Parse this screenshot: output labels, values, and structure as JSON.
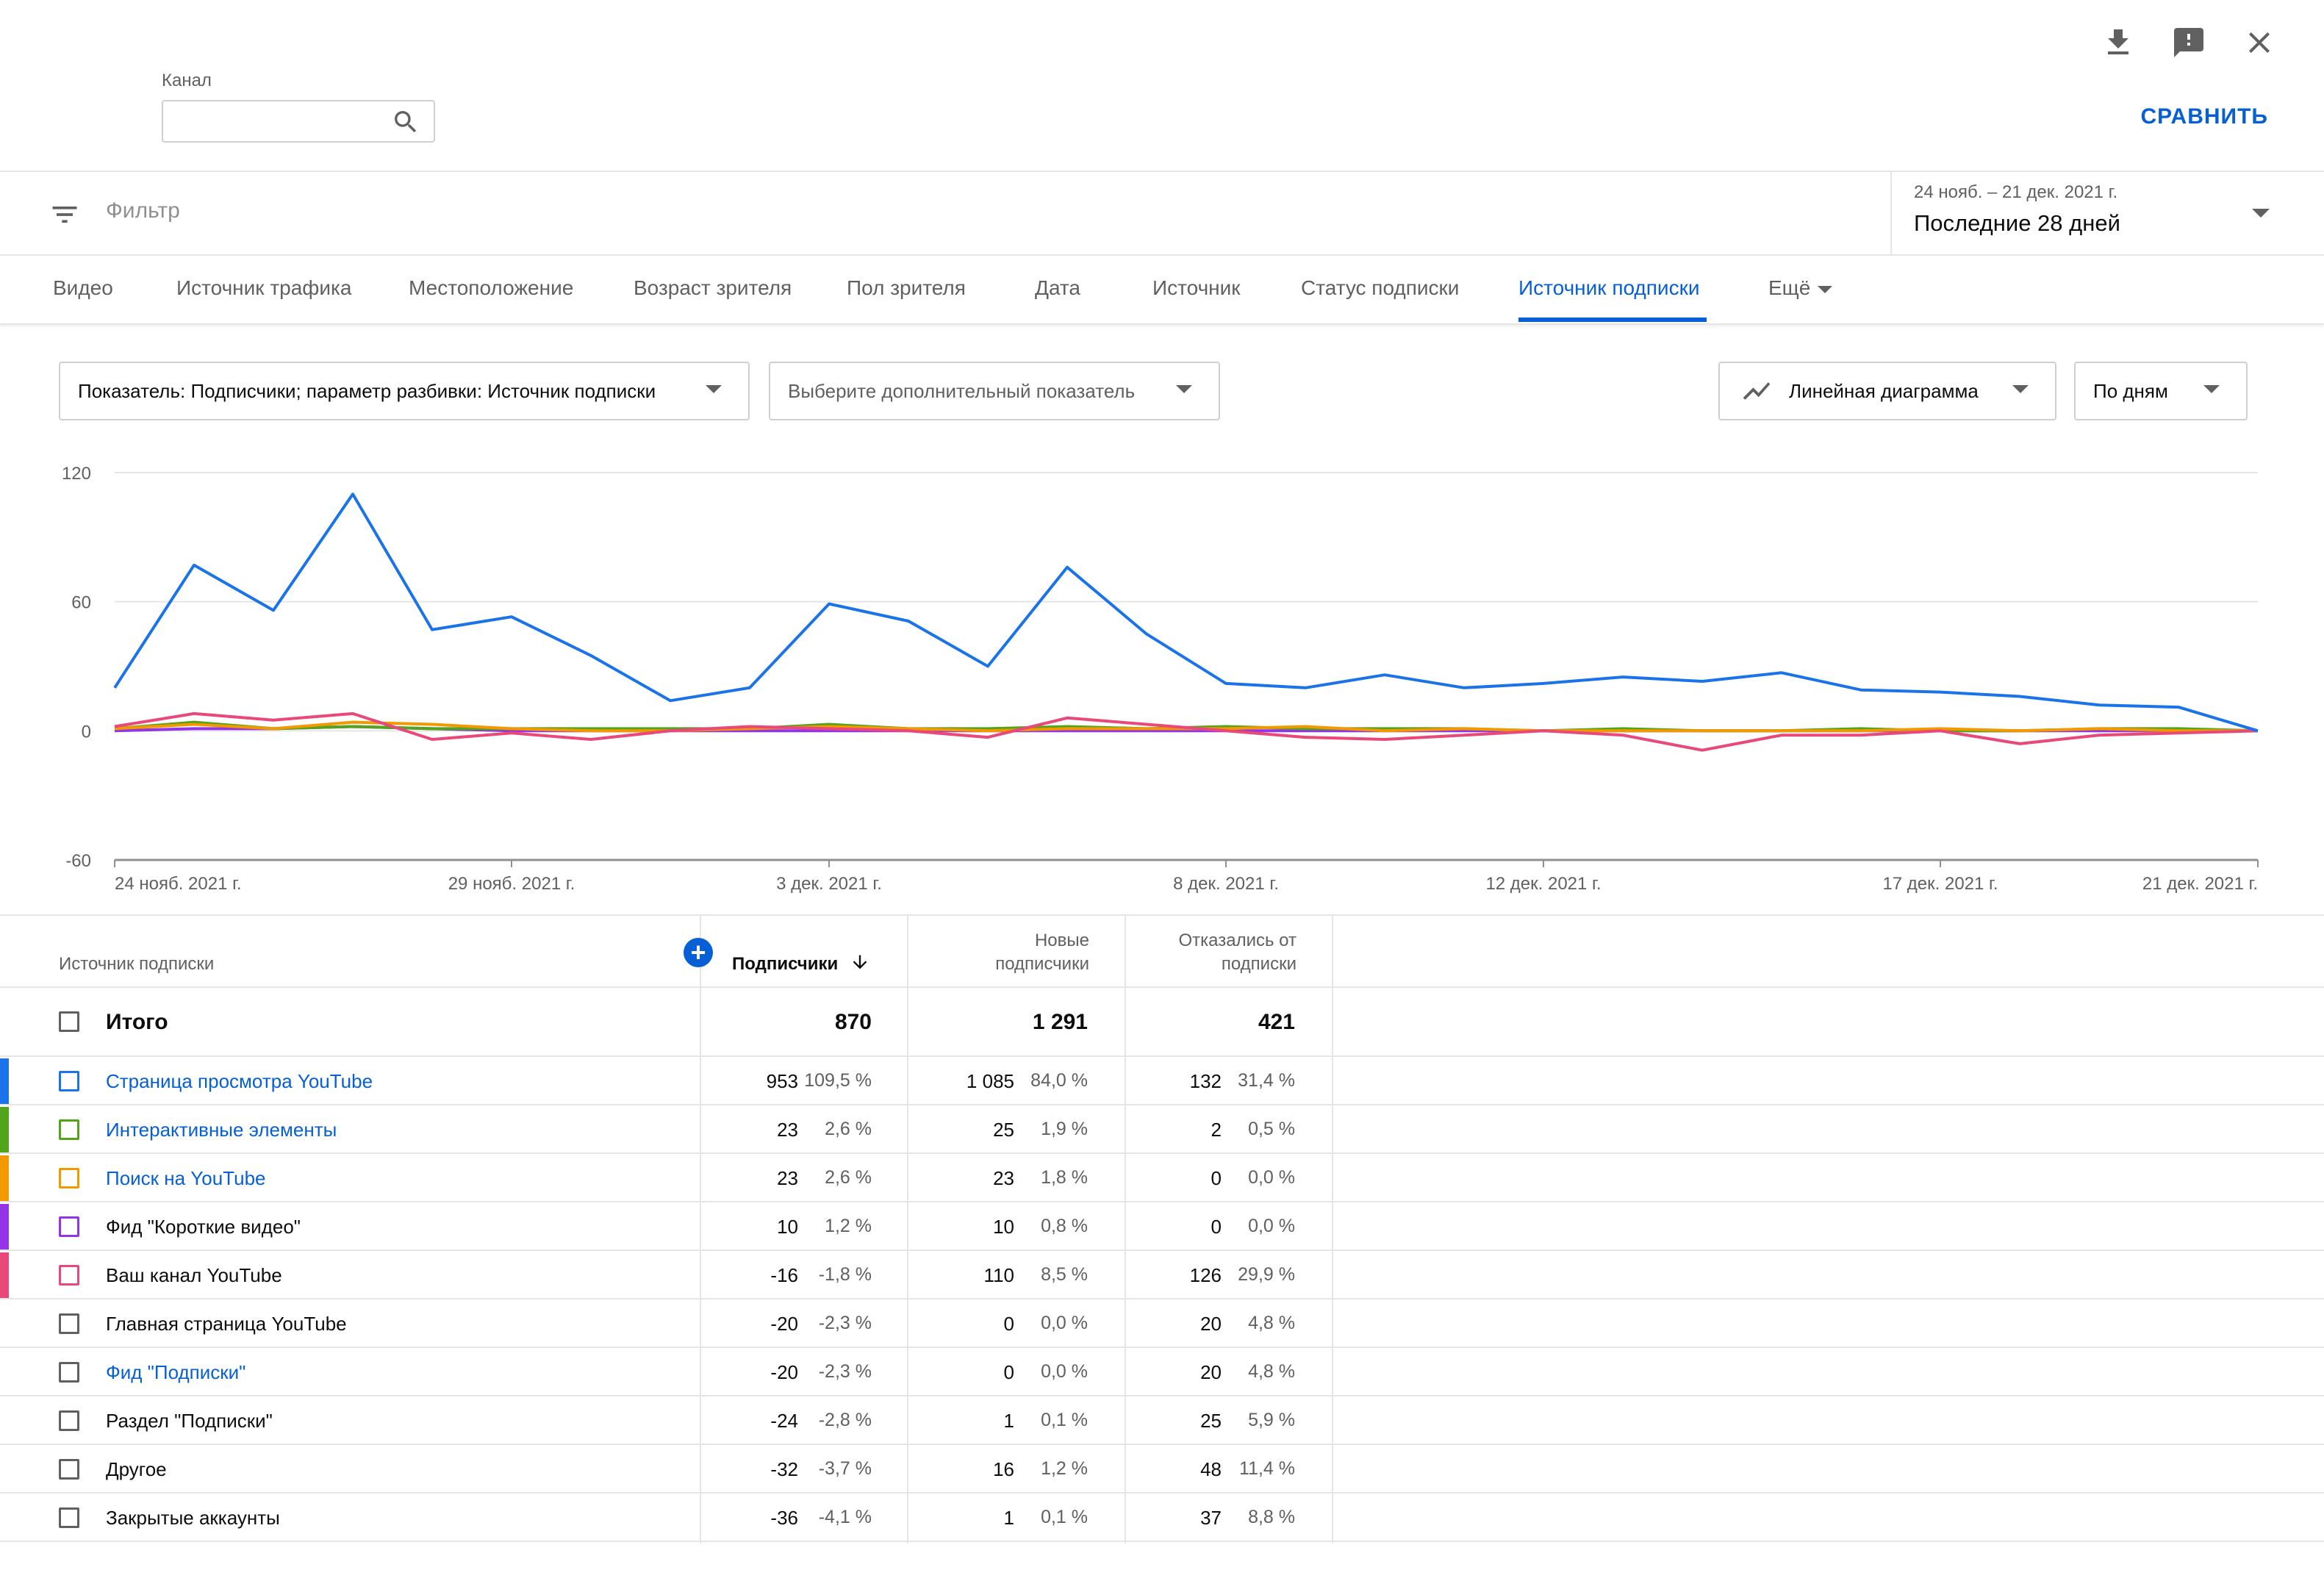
{
  "header": {
    "channel_label": "Канал",
    "channel_value": "",
    "compare_label": "СРАВНИТЬ",
    "icons": [
      "download-icon",
      "feedback-icon",
      "close-icon"
    ]
  },
  "filter": {
    "placeholder": "Фильтр",
    "date_range": "24 нояб. – 21 дек. 2021 г.",
    "period": "Последние 28 дней"
  },
  "tabs": [
    {
      "label": "Видео",
      "active": false
    },
    {
      "label": "Источник трафика",
      "active": false
    },
    {
      "label": "Местоположение",
      "active": false
    },
    {
      "label": "Возраст зрителя",
      "active": false
    },
    {
      "label": "Пол зрителя",
      "active": false
    },
    {
      "label": "Дата",
      "active": false
    },
    {
      "label": "Источник",
      "active": false
    },
    {
      "label": "Статус подписки",
      "active": false
    },
    {
      "label": "Источник подписки",
      "active": true
    },
    {
      "label": "Ещё",
      "active": false
    }
  ],
  "controls": {
    "metric": "Показатель: Подписчики; параметр разбивки: Источник подписки",
    "secondary_metric": "Выберите дополнительный показатель",
    "chart_type": "Линейная диаграмма",
    "granularity": "По дням"
  },
  "chart_data": {
    "type": "line",
    "ylim": [
      -60,
      120
    ],
    "yticks": [
      "120",
      "60",
      "0",
      "-60"
    ],
    "xtick_labels": [
      "24 нояб. 2021 г.",
      "29 нояб. 2021 г.",
      "3 дек. 2021 г.",
      "8 дек. 2021 г.",
      "12 дек. 2021 г.",
      "17 дек. 2021 г.",
      "21 дек. 2021 г."
    ],
    "xtick_index": [
      0,
      5,
      9,
      14,
      18,
      23,
      27
    ],
    "grid": true,
    "series": [
      {
        "color": "#1a73e8",
        "values": [
          20,
          77,
          56,
          110,
          47,
          53,
          35,
          14,
          20,
          59,
          51,
          30,
          76,
          45,
          22,
          20,
          26,
          20,
          22,
          25,
          23,
          27,
          19,
          18,
          16,
          12,
          11,
          0
        ]
      },
      {
        "color": "#e8497a",
        "values": [
          2,
          8,
          5,
          8,
          -4,
          -1,
          -4,
          0,
          2,
          1,
          0,
          -3,
          6,
          3,
          0,
          -3,
          -4,
          -2,
          0,
          -2,
          -9,
          -2,
          -2,
          0,
          -6,
          -2,
          -1,
          0
        ]
      },
      {
        "color": "#f29900",
        "values": [
          1,
          3,
          1,
          4,
          3,
          1,
          0,
          0,
          1,
          2,
          1,
          0,
          1,
          1,
          1,
          2,
          0,
          1,
          0,
          0,
          0,
          0,
          0,
          1,
          0,
          1,
          0,
          0
        ]
      },
      {
        "color": "#52a41a",
        "values": [
          1,
          4,
          1,
          2,
          1,
          1,
          1,
          1,
          1,
          3,
          1,
          1,
          2,
          1,
          2,
          1,
          1,
          1,
          0,
          1,
          0,
          0,
          1,
          0,
          0,
          1,
          1,
          0
        ]
      },
      {
        "color": "#9334e6",
        "values": [
          0,
          1,
          1,
          2,
          1,
          0,
          0,
          0,
          0,
          0,
          0,
          0,
          0,
          0,
          0,
          0,
          0,
          0,
          0,
          0,
          0,
          0,
          0,
          0,
          0,
          0,
          0,
          0
        ]
      }
    ]
  },
  "table": {
    "col_source": "Источник подписки",
    "col_subs": "Подписчики",
    "col_new_1": "Новые",
    "col_new_2": "подписчики",
    "col_lost_1": "Отказались от",
    "col_lost_2": "подписки",
    "total": {
      "label": "Итого",
      "subs": "870",
      "new": "1 291",
      "lost": "421"
    },
    "rows": [
      {
        "label": "Страница просмотра YouTube",
        "link": true,
        "color": "#1a73e8",
        "subs": "953",
        "subs_pct": "109,5 %",
        "new": "1 085",
        "new_pct": "84,0 %",
        "lost": "132",
        "lost_pct": "31,4 %"
      },
      {
        "label": "Интерактивные элементы",
        "link": true,
        "color": "#52a41a",
        "subs": "23",
        "subs_pct": "2,6 %",
        "new": "25",
        "new_pct": "1,9 %",
        "lost": "2",
        "lost_pct": "0,5 %"
      },
      {
        "label": "Поиск на YouTube",
        "link": true,
        "color": "#f29900",
        "subs": "23",
        "subs_pct": "2,6 %",
        "new": "23",
        "new_pct": "1,8 %",
        "lost": "0",
        "lost_pct": "0,0 %"
      },
      {
        "label": "Фид \"Короткие видео\"",
        "link": false,
        "color": "#9334e6",
        "subs": "10",
        "subs_pct": "1,2 %",
        "new": "10",
        "new_pct": "0,8 %",
        "lost": "0",
        "lost_pct": "0,0 %"
      },
      {
        "label": "Ваш канал YouTube",
        "link": false,
        "color": "#e8497a",
        "subs": "-16",
        "subs_pct": "-1,8 %",
        "new": "110",
        "new_pct": "8,5 %",
        "lost": "126",
        "lost_pct": "29,9 %"
      },
      {
        "label": "Главная страница YouTube",
        "link": false,
        "color": "",
        "subs": "-20",
        "subs_pct": "-2,3 %",
        "new": "0",
        "new_pct": "0,0 %",
        "lost": "20",
        "lost_pct": "4,8 %"
      },
      {
        "label": "Фид \"Подписки\"",
        "link": true,
        "color": "",
        "subs": "-20",
        "subs_pct": "-2,3 %",
        "new": "0",
        "new_pct": "0,0 %",
        "lost": "20",
        "lost_pct": "4,8 %"
      },
      {
        "label": "Раздел \"Подписки\"",
        "link": false,
        "color": "",
        "subs": "-24",
        "subs_pct": "-2,8 %",
        "new": "1",
        "new_pct": "0,1 %",
        "lost": "25",
        "lost_pct": "5,9 %"
      },
      {
        "label": "Другое",
        "link": false,
        "color": "",
        "subs": "-32",
        "subs_pct": "-3,7 %",
        "new": "16",
        "new_pct": "1,2 %",
        "lost": "48",
        "lost_pct": "11,4 %"
      },
      {
        "label": "Закрытые аккаунты",
        "link": false,
        "color": "",
        "subs": "-36",
        "subs_pct": "-4,1 %",
        "new": "1",
        "new_pct": "0,1 %",
        "lost": "37",
        "lost_pct": "8,8 %"
      }
    ]
  },
  "colors": {
    "accent": "#065fd4",
    "link": "#065fd4"
  }
}
